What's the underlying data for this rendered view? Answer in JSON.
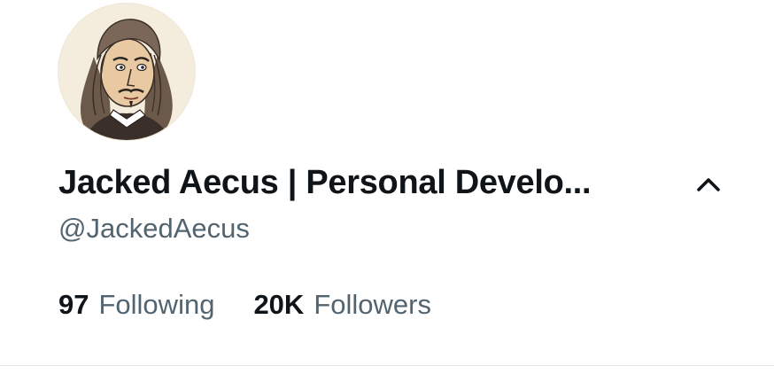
{
  "profile": {
    "display_name": "Jacked Aecus | Personal Develo...",
    "handle": "@JackedAecus",
    "avatar_icon": "portrait-illustration"
  },
  "stats": {
    "following_count": "97",
    "following_label": "Following",
    "followers_count": "20K",
    "followers_label": "Followers"
  },
  "controls": {
    "collapse_icon": "chevron-up-icon"
  },
  "colors": {
    "primary_text": "#0f1419",
    "secondary_text": "#536471",
    "divider": "#e6e9ec",
    "background": "#ffffff"
  }
}
